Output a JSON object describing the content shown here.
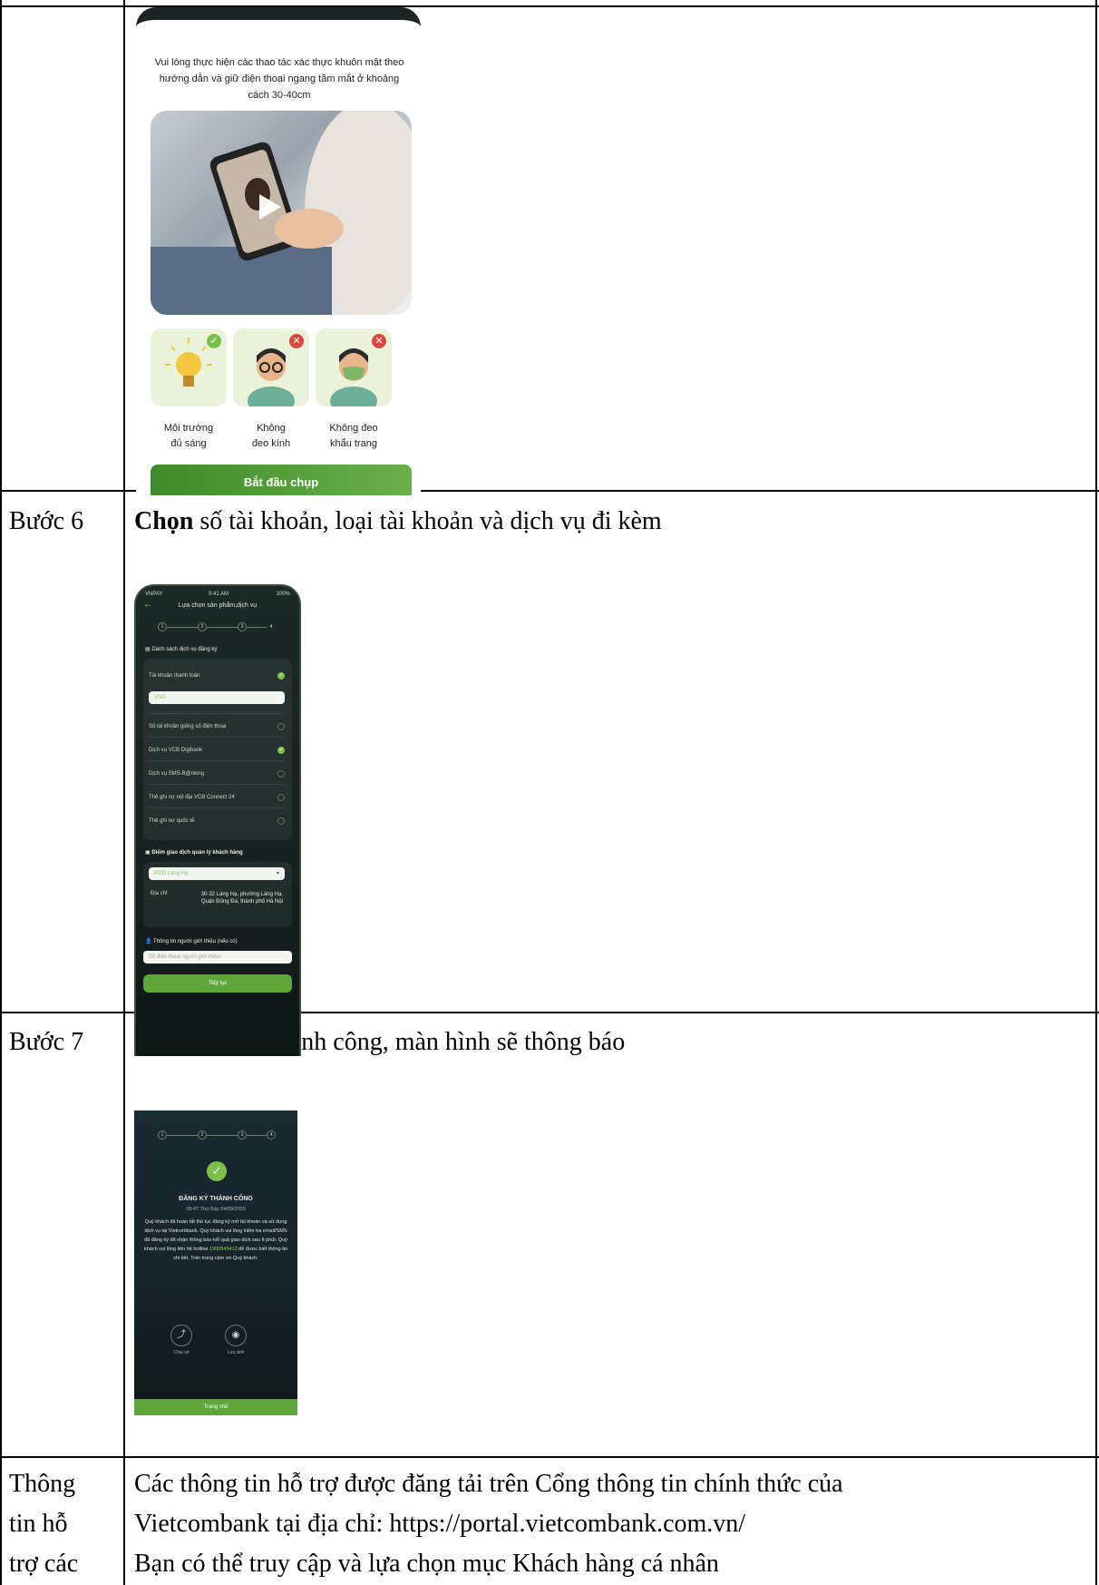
{
  "table": {
    "rows": [
      {
        "label": "",
        "content": ""
      },
      {
        "label": "Bước 6",
        "content_bold": "Chọn",
        "content_rest": " số tài khoản, loại tài khoản và dịch vụ đi kèm"
      },
      {
        "label": "Bước 7",
        "content": "Nếu đăng ký thành công, màn hình sẽ thông báo"
      },
      {
        "label_lines": [
          "Thông",
          "tin hỗ",
          "trợ các"
        ],
        "content_lines": [
          "Các thông tin hỗ trợ được đăng tải trên Cổng thông tin chính thức của",
          "Vietcombank tại địa chỉ: https://portal.vietcombank.com.vn/",
          "Bạn có thể truy cập và lựa chọn mục Khách hàng cá nhân"
        ]
      }
    ]
  },
  "face_capture": {
    "instruction": "Vui lòng thực hiện các thao tác xác thực khuôn mặt theo hướng dẫn và giữ điện thoại ngang tầm mắt ở khoảng cách 30-40cm",
    "tips": [
      {
        "label_line1": "Môi trường",
        "label_line2": "đủ sáng",
        "status": "ok"
      },
      {
        "label_line1": "Không",
        "label_line2": "đeo kính",
        "status": "no"
      },
      {
        "label_line1": "Không đeo",
        "label_line2": "khẩu trang",
        "status": "no"
      }
    ],
    "start_button": "Bắt đầu chụp",
    "colors": {
      "accent": "#5ea63a",
      "ok": "#7cc04b",
      "no": "#e0443c"
    }
  },
  "product_select": {
    "status_left": "VNPAY",
    "status_time": "9:41 AM",
    "status_battery": "100%",
    "header": "Lựa chọn sản phẩm,dịch vụ",
    "steps": [
      "1",
      "2",
      "3",
      "4"
    ],
    "services_title": "Danh sách dịch vụ đăng ký",
    "services": [
      {
        "label": "Tài khoản thanh toán",
        "checked": true
      },
      {
        "label": "Số tài khoản giống số điện thoại",
        "checked": false
      },
      {
        "label": "Dịch vụ VCB Digibank",
        "checked": true
      },
      {
        "label": "Dịch vụ SMS-B@nking",
        "checked": false
      },
      {
        "label": "Thẻ ghi nợ nội địa VCB Connect 24",
        "checked": false
      },
      {
        "label": "Thẻ ghi nợ quốc tế",
        "checked": false
      }
    ],
    "currency_value": "VND",
    "branch_title": "Điểm giao dịch quản lý khách hàng",
    "branch_value": "PGD Láng Hạ",
    "address_label": "Địa chỉ",
    "address_value": "30-32 Láng Hạ, phường Láng Hạ, Quận Đống Đa, thành phố Hà Nội",
    "referrer_title": "Thông tin người giới thiệu (nếu có)",
    "referrer_placeholder": "Số điện thoại người giới thiệu",
    "continue_button": "Tiếp tục"
  },
  "success": {
    "steps": [
      "1",
      "2",
      "3",
      "4"
    ],
    "title": "ĐĂNG KÝ THÀNH CÔNG",
    "time": "09:47 Thứ Bảy 04/09/2020",
    "message_part1": "Quý khách đã hoàn tất thủ tục đăng ký mở tài khoản và sử dụng dịch vụ tại Vietcombank. Quý khách vui lòng kiểm tra email/SMS đã đăng ký để nhận thông báo kết quả giao dịch sau ít phút. Quý khách vui lòng liên hệ hotline",
    "hotline": "1900545413",
    "message_part2": "để được biết thông tin chi tiết. Trân trọng cảm ơn Quý khách.",
    "share_label": "Chia sẻ",
    "save_label": "Lưu ảnh",
    "home_button": "Trang chủ"
  }
}
